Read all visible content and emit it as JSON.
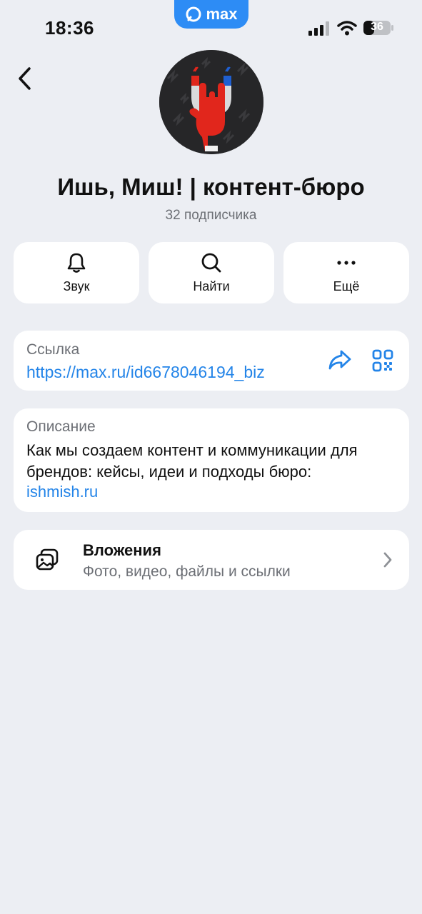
{
  "status_bar": {
    "time": "18:36",
    "app_badge": "max",
    "battery_level": "36"
  },
  "profile": {
    "title": "Ишь, Миш! | контент-бюро",
    "subscribers": "32 подписчика"
  },
  "actions": [
    {
      "label": "Звук",
      "icon": "bell-icon"
    },
    {
      "label": "Найти",
      "icon": "search-icon"
    },
    {
      "label": "Ещё",
      "icon": "more-icon"
    }
  ],
  "link_card": {
    "label": "Ссылка",
    "url": "https://max.ru/id6678046194_biz"
  },
  "description_card": {
    "label": "Описание",
    "text": "Как мы создаем контент и коммуникации для брендов: кейсы, идеи и подходы бюро:",
    "link": "ishmish.ru"
  },
  "attachments": {
    "title": "Вложения",
    "subtitle": "Фото, видео, файлы и ссылки"
  },
  "colors": {
    "accent": "#2384e8",
    "background": "#eceef3",
    "brand_pill": "#2d8cf5"
  }
}
